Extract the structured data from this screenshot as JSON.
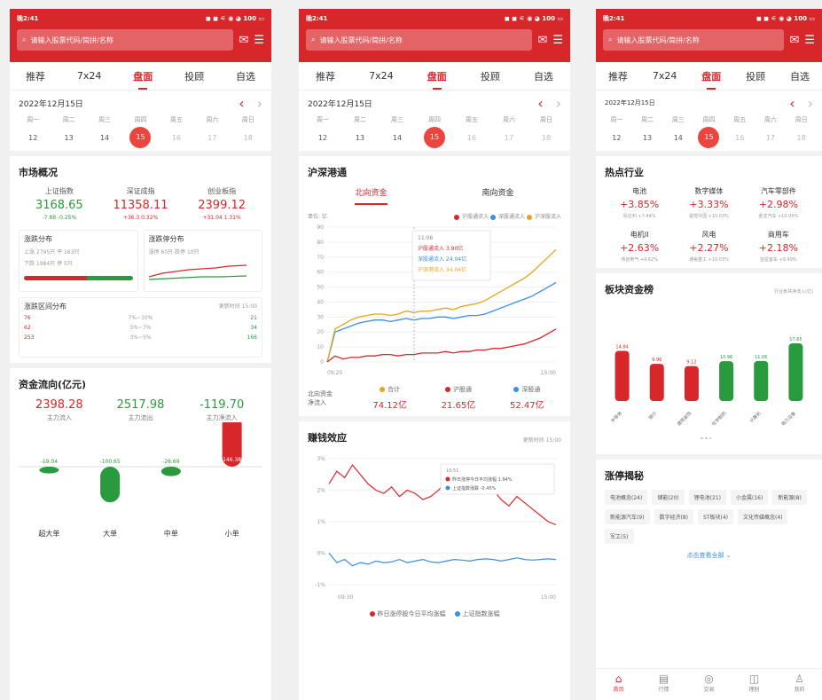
{
  "status": {
    "time": "晚2:41",
    "right": "◼ ◼ ⚟ ◉ ◕ 100 ▭"
  },
  "search": {
    "placeholder": "请输入股票代码/简拼/名称"
  },
  "tabs": [
    "推荐",
    "7x24",
    "盘面",
    "投顾",
    "自选"
  ],
  "active_tab": "盘面",
  "date": "2022年12月15日",
  "weekdays": [
    "周一",
    "周二",
    "周三",
    "周四",
    "周五",
    "周六",
    "周日"
  ],
  "days": [
    "12",
    "13",
    "14",
    "15",
    "16",
    "17",
    "18"
  ],
  "screen1": {
    "market_title": "市场概况",
    "indices": [
      {
        "name": "上证指数",
        "value": "3168.65",
        "change": "-7.88 -0.25%",
        "dir": "down"
      },
      {
        "name": "深证成指",
        "value": "11358.11",
        "change": "+36.3 0.32%",
        "dir": "up"
      },
      {
        "name": "创业板指",
        "value": "2399.12",
        "change": "+31.04 1.31%",
        "dir": "up"
      }
    ],
    "updown_title": "涨跌分布",
    "updown_rows": [
      "上涨 2795只  平 163只",
      "下跌 1984只  停 5只"
    ],
    "updown_up_ratio": 0.58,
    "limit_title": "涨跌停分布",
    "limit_rows": "涨停 60只  跌停 10只",
    "range_title": "涨跌区间分布",
    "range_time": "更新时间  15:00",
    "range_rows": [
      {
        "left": "76",
        "mid": "7%~10%",
        "right": "21"
      },
      {
        "left": "62",
        "mid": "5%~7%",
        "right": "34"
      },
      {
        "left": "253",
        "mid": "3%~5%",
        "right": "166"
      }
    ],
    "flow_title": "资金流向(亿元)",
    "flows": [
      {
        "value": "2398.28",
        "label": "主力流入",
        "cls": "red"
      },
      {
        "value": "2517.98",
        "label": "主力流出",
        "cls": "green"
      },
      {
        "value": "-119.70",
        "label": "主力净流入",
        "cls": "green"
      }
    ],
    "flow_bars": [
      {
        "label": "超大单",
        "value": -19.04,
        "text": "-19.04"
      },
      {
        "label": "大单",
        "value": -100.65,
        "text": "-100.65"
      },
      {
        "label": "中单",
        "value": -26.69,
        "text": "-26.69"
      },
      {
        "label": "小单",
        "value": 146.38,
        "text": "146.38"
      }
    ]
  },
  "screen2": {
    "hk_title": "沪深港通",
    "subtabs": [
      "北向资金",
      "南向资金"
    ],
    "unit": "单位: 亿",
    "legend": [
      "沪股通流入",
      "深股通流入",
      "沪深股流入"
    ],
    "tooltip": {
      "time": "11:06",
      "l1": "沪股通流入 3.90亿",
      "l2": "深股通流入 24.04亿",
      "l3": "沪深港流入 34.04亿"
    },
    "y_ticks": [
      "90",
      "80",
      "70",
      "60",
      "50",
      "40",
      "30",
      "20",
      "10",
      "0"
    ],
    "x_start": "09:25",
    "x_end": "15:00",
    "net_label": "北向资金\n净流入",
    "net": [
      {
        "name": "合计",
        "value": "74.12亿",
        "color": "#e8a41c"
      },
      {
        "name": "沪股通",
        "value": "21.65亿",
        "color": "#d8272b"
      },
      {
        "name": "深股通",
        "value": "52.47亿",
        "color": "#3a8ee6"
      }
    ],
    "profit_title": "赚钱效应",
    "profit_time": "更新时间  15:00",
    "profit_y": [
      "3%",
      "2%",
      "1%",
      "0%",
      "-1%"
    ],
    "profit_x_start": "09:30",
    "profit_x_end": "15:00",
    "profit_tip": {
      "time": "10:51",
      "l1": "昨日涨停今日平均涨幅 1.94%",
      "l2": "上证指数涨跌 -0.45%"
    },
    "profit_legend": [
      "昨日涨停股今日平均涨幅",
      "上证指数涨幅"
    ]
  },
  "screen3": {
    "hot_title": "热点行业",
    "hot": [
      {
        "name": "电池",
        "pct": "+3.85%",
        "lead": "科达利 +7.44%"
      },
      {
        "name": "数字媒体",
        "pct": "+3.33%",
        "lead": "视觉中国 +10.03%"
      },
      {
        "name": "汽车零部件",
        "pct": "+2.98%",
        "lead": "金龙汽车 +10.04%"
      },
      {
        "name": "电机II",
        "pct": "+2.63%",
        "lead": "伟创电气 +9.62%"
      },
      {
        "name": "风电",
        "pct": "+2.27%",
        "lead": "通裕重工 +10.03%"
      },
      {
        "name": "商用车",
        "pct": "+2.18%",
        "lead": "亚星客车 +9.99%"
      }
    ],
    "fund_title": "板块资金榜",
    "fund_note": "行业板块净流入(亿)",
    "fund_bars": [
      {
        "value": 14.84,
        "text": "14.84",
        "label": "半导体"
      },
      {
        "value": 9.96,
        "text": "9.96",
        "label": "银行"
      },
      {
        "value": 9.12,
        "text": "9.12",
        "label": "建筑装饰"
      },
      {
        "value": 10.96,
        "text": "10.96",
        "label": "化学制药"
      },
      {
        "value": 11.06,
        "text": "11.06",
        "label": "计算机"
      },
      {
        "value": 17.65,
        "text": "17.65",
        "label": "电力设备"
      }
    ],
    "limit_title": "涨停揭秘",
    "chips": [
      "电池概念(24)",
      "储能(20)",
      "锂电池(21)",
      "小金属(16)",
      "新能源(8)",
      "新能源汽车(9)",
      "数字经济(8)",
      "ST板块(4)",
      "文化传媒概念(4)",
      "军工(5)"
    ],
    "more": "点击查看全部 ⌄",
    "tabbar": [
      {
        "label": "首页",
        "icon": "⌂"
      },
      {
        "label": "行情",
        "icon": "▤"
      },
      {
        "label": "交易",
        "icon": "◎"
      },
      {
        "label": "理财",
        "icon": "◫"
      },
      {
        "label": "我的",
        "icon": "♙"
      }
    ]
  },
  "colors": {
    "brand": "#d8272b",
    "up": "#d8272b",
    "down": "#2a9a3e",
    "sh": "#d8272b",
    "sz": "#3a8ee6",
    "total": "#e8a41c"
  }
}
